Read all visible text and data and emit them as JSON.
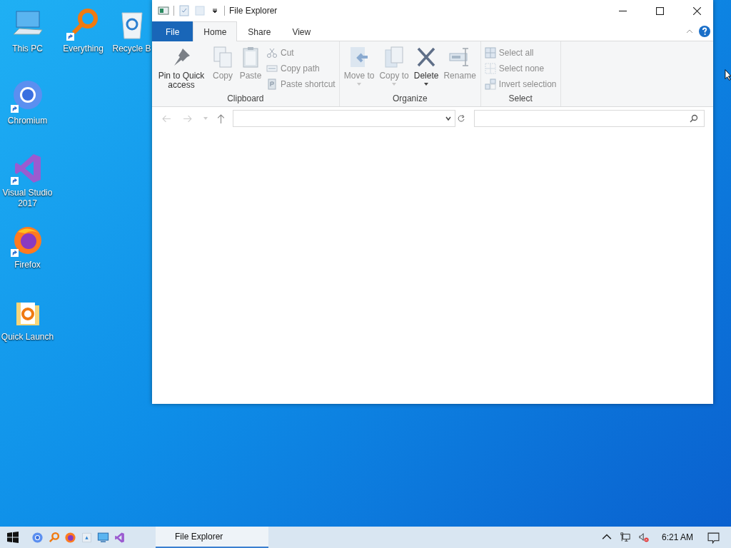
{
  "desktop_icons": [
    {
      "label": "This PC",
      "kind": "pc",
      "shortcut": false
    },
    {
      "label": "Everything",
      "kind": "search",
      "shortcut": true
    },
    {
      "label": "Recycle B",
      "kind": "recycle",
      "shortcut": false
    },
    {
      "label": "Chromium",
      "kind": "chromium",
      "shortcut": true
    },
    {
      "label": "Visual Studio 2017",
      "kind": "vs",
      "shortcut": true
    },
    {
      "label": "Firefox",
      "kind": "firefox",
      "shortcut": true
    },
    {
      "label": "Quick Launch",
      "kind": "quicklaunch",
      "shortcut": false
    }
  ],
  "window": {
    "title": "File Explorer",
    "tabs": [
      {
        "label": "File",
        "kind": "file",
        "selected": false
      },
      {
        "label": "Home",
        "kind": "tab",
        "selected": true
      },
      {
        "label": "Share",
        "kind": "tab",
        "selected": false
      },
      {
        "label": "View",
        "kind": "tab",
        "selected": false
      }
    ],
    "ribbon_groups": [
      {
        "label": "Clipboard",
        "items": [
          {
            "label": "Pin to Quick access",
            "kind": "large",
            "disabled": false,
            "dropdown": false
          },
          {
            "label": "Copy",
            "kind": "large",
            "disabled": true,
            "dropdown": false
          },
          {
            "label": "Paste",
            "kind": "large",
            "disabled": true,
            "dropdown": false
          },
          {
            "kind": "stack",
            "items": [
              {
                "label": "Cut",
                "disabled": true
              },
              {
                "label": "Copy path",
                "disabled": true
              },
              {
                "label": "Paste shortcut",
                "disabled": true
              }
            ]
          }
        ]
      },
      {
        "label": "Organize",
        "items": [
          {
            "label": "Move to",
            "kind": "large",
            "disabled": true,
            "dropdown": true
          },
          {
            "label": "Copy to",
            "kind": "large",
            "disabled": true,
            "dropdown": true
          },
          {
            "label": "Delete",
            "kind": "large",
            "disabled": false,
            "dropdown": true
          },
          {
            "label": "Rename",
            "kind": "large",
            "disabled": true,
            "dropdown": false
          }
        ]
      },
      {
        "label": "Select",
        "items": [
          {
            "kind": "stack",
            "items": [
              {
                "label": "Select all",
                "disabled": true
              },
              {
                "label": "Select none",
                "disabled": true
              },
              {
                "label": "Invert selection",
                "disabled": true
              }
            ]
          }
        ]
      }
    ]
  },
  "taskbar": {
    "pinned": [
      {
        "kind": "chromium"
      },
      {
        "kind": "search"
      },
      {
        "kind": "firefox"
      },
      {
        "kind": "quicklaunch"
      },
      {
        "kind": "pc"
      },
      {
        "kind": "vs"
      }
    ],
    "windows": [
      {
        "label": "File Explorer",
        "selected": true
      }
    ],
    "clock": "6:21 AM"
  }
}
